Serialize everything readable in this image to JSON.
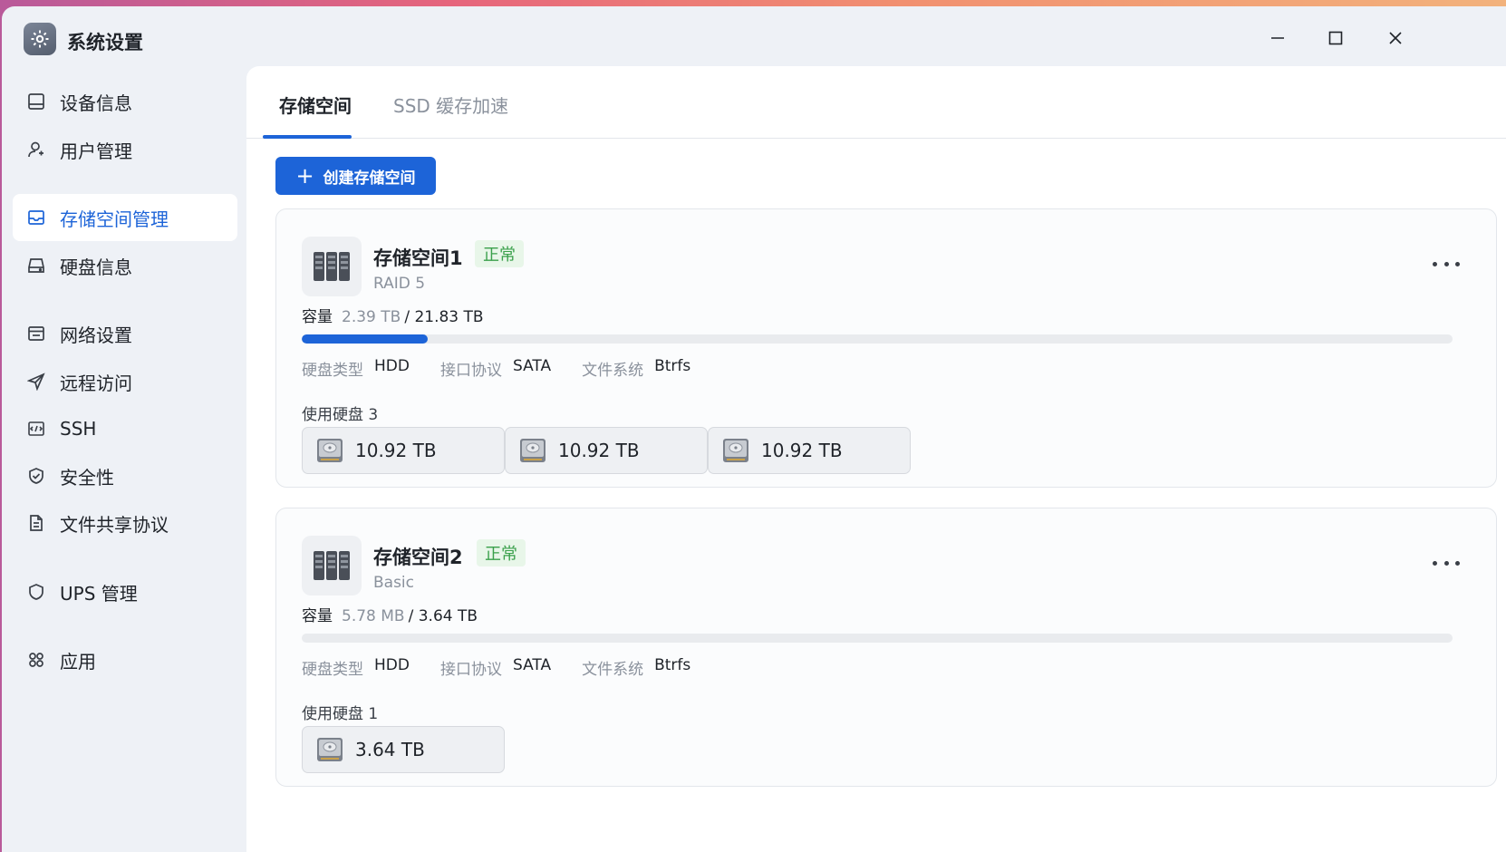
{
  "app": {
    "title": "系统设置"
  },
  "colors": {
    "accent": "#1d64d8",
    "status_ok": "#3aa04b"
  },
  "sidebar": {
    "items": [
      {
        "label": "设备信息",
        "icon": "monitor-icon"
      },
      {
        "label": "用户管理",
        "icon": "user-icon"
      },
      {
        "label": "存储空间管理",
        "icon": "storage-icon",
        "active": true
      },
      {
        "label": "硬盘信息",
        "icon": "hard-drive-icon"
      },
      {
        "label": "网络设置",
        "icon": "network-icon"
      },
      {
        "label": "远程访问",
        "icon": "send-icon"
      },
      {
        "label": "SSH",
        "icon": "terminal-icon"
      },
      {
        "label": "安全性",
        "icon": "shield-check-icon"
      },
      {
        "label": "文件共享协议",
        "icon": "document-icon"
      },
      {
        "label": "UPS 管理",
        "icon": "shield-icon"
      },
      {
        "label": "应用",
        "icon": "apps-icon"
      }
    ]
  },
  "tabs": [
    {
      "label": "存储空间",
      "active": true
    },
    {
      "label": "SSD 缓存加速"
    }
  ],
  "toolbar": {
    "create_label": "创建存储空间"
  },
  "labels": {
    "capacity": "容量",
    "disk_type": "硬盘类型",
    "interface": "接口协议",
    "filesystem": "文件系统",
    "disks_used": "使用硬盘"
  },
  "pools": [
    {
      "name": "存储空间1",
      "status": "正常",
      "raid": "RAID 5",
      "used": "2.39 TB",
      "total": "/ 21.83 TB",
      "usage_fraction": 0.1095,
      "disk_type": "HDD",
      "interface": "SATA",
      "filesystem": "Btrfs",
      "disk_count": "3",
      "disks": [
        "10.92 TB",
        "10.92 TB",
        "10.92 TB"
      ]
    },
    {
      "name": "存储空间2",
      "status": "正常",
      "raid": "Basic",
      "used": "5.78 MB",
      "total": "/ 3.64 TB",
      "usage_fraction": 1.5e-06,
      "disk_type": "HDD",
      "interface": "SATA",
      "filesystem": "Btrfs",
      "disk_count": "1",
      "disks": [
        "3.64 TB"
      ]
    }
  ]
}
